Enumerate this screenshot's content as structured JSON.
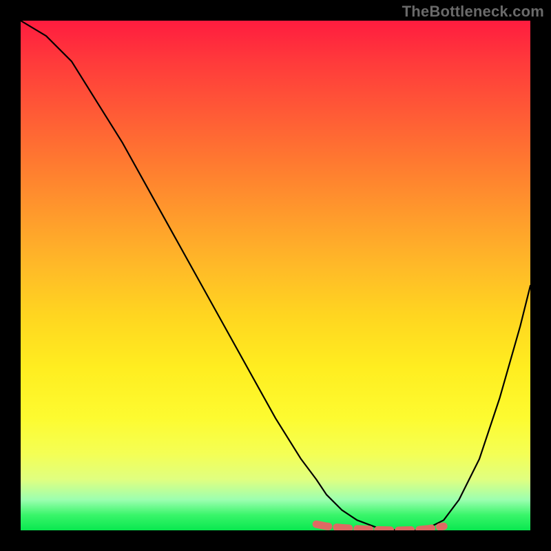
{
  "watermark": "TheBottleneck.com",
  "chart_data": {
    "type": "line",
    "title": "",
    "xlabel": "",
    "ylabel": "",
    "xlim": [
      0,
      100
    ],
    "ylim": [
      0,
      100
    ],
    "series": [
      {
        "name": "curve",
        "color": "#000000",
        "x": [
          0,
          5,
          10,
          15,
          20,
          25,
          30,
          35,
          40,
          45,
          50,
          55,
          58,
          60,
          63,
          66,
          70,
          74,
          78,
          80,
          83,
          86,
          90,
          94,
          98,
          100
        ],
        "y": [
          100,
          97,
          92,
          84,
          76,
          67,
          58,
          49,
          40,
          31,
          22,
          14,
          10,
          7,
          4,
          2,
          0.5,
          0,
          0,
          0.5,
          2,
          6,
          14,
          26,
          40,
          48
        ]
      },
      {
        "name": "highlight",
        "color": "#e06a63",
        "x": [
          58,
          60,
          63,
          66,
          70,
          74,
          78,
          80,
          83
        ],
        "y": [
          1.2,
          0.8,
          0.5,
          0.3,
          0.1,
          0,
          0.1,
          0.3,
          0.8
        ]
      }
    ],
    "gradient_top_color": "#ff1c3f",
    "gradient_bottom_color": "#09e84f"
  }
}
